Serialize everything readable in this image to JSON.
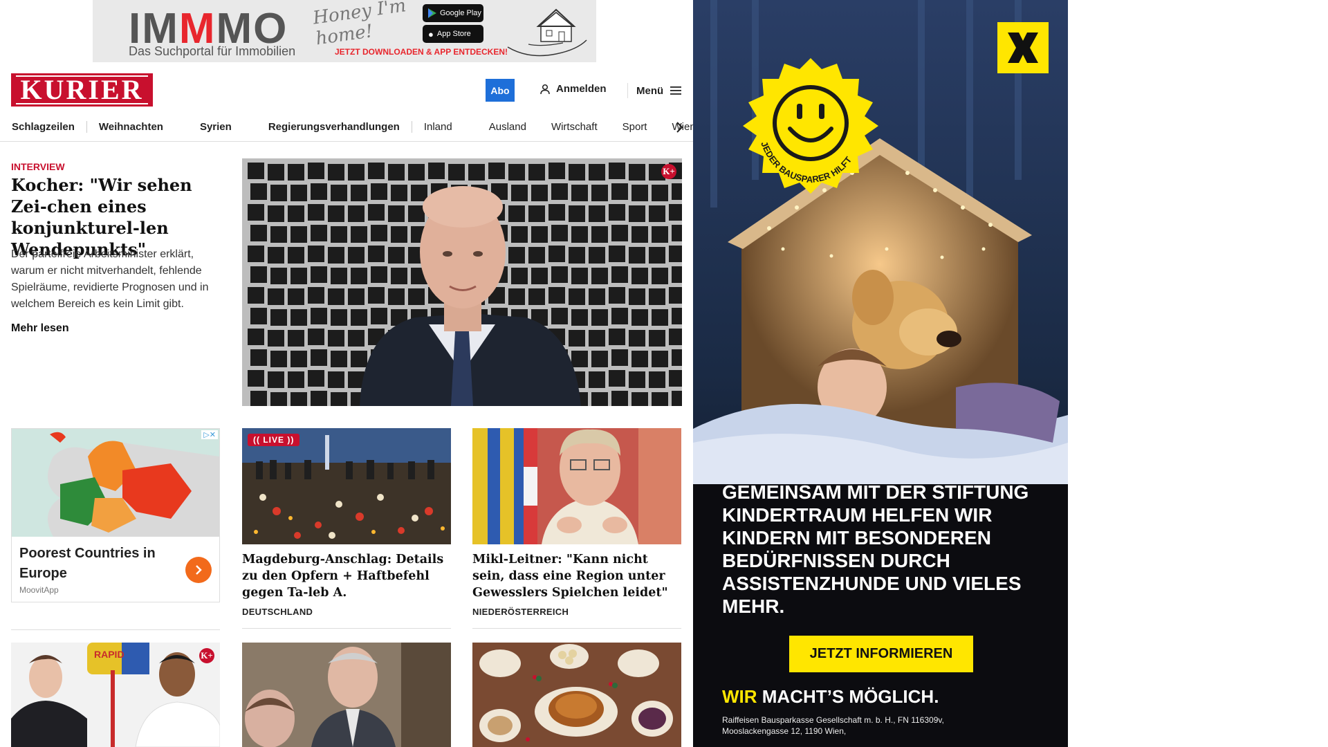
{
  "top_ad": {
    "brand_part1": "IM",
    "brand_part2": "M",
    "brand_part3": "MO",
    "subtitle": "Das Suchportal für Immobilien",
    "handwriting": "Honey I'm home!",
    "google_play": "Google Play",
    "app_store": "App Store",
    "cta": "JETZT DOWNLOADEN & APP ENTDECKEN!"
  },
  "header": {
    "logo": "KURIER",
    "abo": "Abo",
    "login": "Anmelden",
    "menu": "Menü"
  },
  "nav": {
    "items": [
      {
        "label": "Schlagzeilen"
      },
      {
        "label": "Weihnachten"
      },
      {
        "label": "Syrien"
      },
      {
        "label": "Regierungsverhandlungen"
      },
      {
        "label": "Inland"
      },
      {
        "label": "Ausland"
      },
      {
        "label": "Wirtschaft"
      },
      {
        "label": "Sport"
      },
      {
        "label": "Wien"
      }
    ]
  },
  "lead": {
    "kicker": "INTERVIEW",
    "title": "Kocher: \"Wir sehen Zei-chen eines konjunkturel-len Wendepunkts\"",
    "teaser": "Der parteifreie Arbeitsminister erklärt, warum er nicht mitverhandelt, fehlende Spielräume, revidierte Prognosen und in welchem Bereich es kein Limit gibt.",
    "read_more": "Mehr lesen",
    "premium_badge": "K+"
  },
  "ad_card": {
    "title": "Poorest Countries in Europe",
    "source": "MoovitApp",
    "adchoice": "▷✕"
  },
  "cards": [
    {
      "live": "(( LIVE ))",
      "title": "Magdeburg-Anschlag: Details zu den Opfern + Haftbefehl gegen Ta-leb A.",
      "section": "DEUTSCHLAND"
    },
    {
      "title": "Mikl-Leitner: \"Kann nicht sein, dass eine Region unter Gewesslers Spielchen leidet\"",
      "section": "NIEDERÖSTERREICH"
    }
  ],
  "bottom_row": {
    "premium_badge": "K+",
    "sign_text": "RAPID"
  },
  "side_ad": {
    "badge_text": "JEDER BAUSPARER HILFT",
    "headline": "GEMEINSAM MIT DER STIFTUNG KINDERTRAUM HELFEN WIR KINDERN MIT BESONDEREN BEDÜRFNISSEN DURCH ASSISTENZHUNDE UND VIELES MEHR.",
    "cta": "JETZT INFORMIEREN",
    "slogan_part1": "WIR",
    "slogan_part2": " MACHT’S MÖGLICH.",
    "legal": "Raiffeisen Bausparkasse Gesellschaft m. b. H., FN 116309v, Mooslackengasse 12, 1190 Wien,"
  },
  "colors": {
    "brand_red": "#c8102e",
    "abo_blue": "#1e6fd9",
    "ad_yellow": "#ffe600"
  }
}
